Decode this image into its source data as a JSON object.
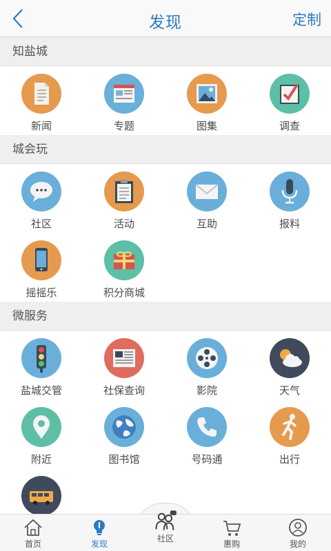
{
  "header": {
    "title": "发现",
    "right_action": "定制"
  },
  "sections": [
    {
      "title": "知盐城",
      "items": [
        {
          "label": "新闻",
          "icon": "news-document-icon",
          "color": "#e59a4e"
        },
        {
          "label": "专题",
          "icon": "webpage-icon",
          "color": "#6aafd9"
        },
        {
          "label": "图集",
          "icon": "picture-frame-icon",
          "color": "#e59a4e"
        },
        {
          "label": "调查",
          "icon": "checkbox-survey-icon",
          "color": "#5cbfa6"
        }
      ]
    },
    {
      "title": "城会玩",
      "items": [
        {
          "label": "社区",
          "icon": "chat-bubble-icon",
          "color": "#6aafd9"
        },
        {
          "label": "活动",
          "icon": "clipboard-icon",
          "color": "#e59a4e"
        },
        {
          "label": "互助",
          "icon": "envelope-icon",
          "color": "#6aafd9"
        },
        {
          "label": "报料",
          "icon": "microphone-icon",
          "color": "#6aafd9"
        },
        {
          "label": "摇摇乐",
          "icon": "smartphone-icon",
          "color": "#e59a4e"
        },
        {
          "label": "积分商城",
          "icon": "gift-box-icon",
          "color": "#5cbfa6"
        }
      ]
    },
    {
      "title": "微服务",
      "items": [
        {
          "label": "盐城交管",
          "icon": "traffic-light-icon",
          "color": "#6aafd9"
        },
        {
          "label": "社保查询",
          "icon": "newspaper-icon",
          "color": "#e06b5f"
        },
        {
          "label": "影院",
          "icon": "film-reel-icon",
          "color": "#6aafd9"
        },
        {
          "label": "天气",
          "icon": "sun-cloud-icon",
          "color": "#3f4a5c"
        },
        {
          "label": "附近",
          "icon": "location-pin-icon",
          "color": "#5cbfa6"
        },
        {
          "label": "图书馆",
          "icon": "globe-icon",
          "color": "#6aafd9"
        },
        {
          "label": "号码通",
          "icon": "phone-icon",
          "color": "#6aafd9"
        },
        {
          "label": "出行",
          "icon": "running-man-icon",
          "color": "#e59a4e"
        },
        {
          "label": "",
          "icon": "bus-icon",
          "color": "#3f4a5c"
        }
      ]
    }
  ],
  "tabbar": [
    {
      "label": "首页",
      "icon": "home-icon",
      "active": false
    },
    {
      "label": "发现",
      "icon": "lightbulb-icon",
      "active": true
    },
    {
      "label": "社区",
      "icon": "people-icon",
      "active": false
    },
    {
      "label": "惠购",
      "icon": "shopping-cart-icon",
      "active": false
    },
    {
      "label": "我的",
      "icon": "user-icon",
      "active": false
    }
  ],
  "colors": {
    "accent": "#2a7bc2",
    "section_bg": "#efefef"
  }
}
